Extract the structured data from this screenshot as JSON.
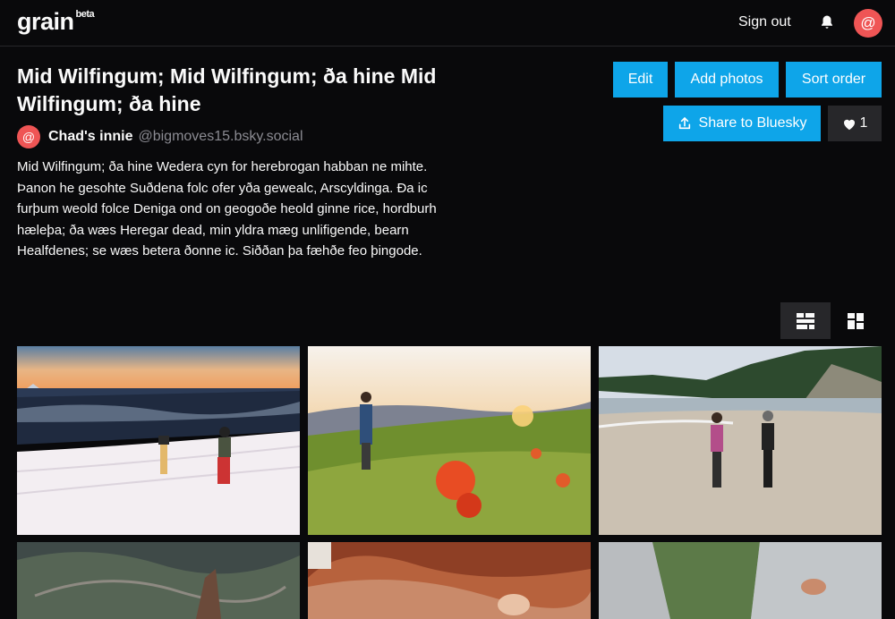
{
  "header": {
    "logo": "grain",
    "logo_sup": "beta",
    "sign_out_label": "Sign out",
    "avatar_glyph": "@"
  },
  "gallery": {
    "title": "Mid Wilfingum; Mid Wilfingum; ða hine Mid Wilfingum; ða hine",
    "author_name": "Chad's innie",
    "author_handle": "@bigmoves15.bsky.social",
    "author_avatar_glyph": "@",
    "description": "Mid Wilfingum; ða hine Wedera cyn for herebrogan habban ne mihte. Þanon he gesohte Suðdena folc ofer yða gewealc, Arscyldinga. Ða ic furþum weold folce Deniga ond on geogoðe heold ginne rice, hordburh hæleþa; ða wæs Heregar dead, min yldra mæg unlifigende, bearn Healfdenes; se wæs betera ðonne ic. Siððan þa fæhðe feo þingode."
  },
  "actions": {
    "edit_label": "Edit",
    "add_photos_label": "Add photos",
    "sort_order_label": "Sort order",
    "share_label": "Share to Bluesky",
    "like_count": "1"
  },
  "view_toggle": {
    "active": "masonry"
  },
  "colors": {
    "accent": "#0ea5e9",
    "avatar": "#ef5555",
    "background": "#09090b",
    "muted_button": "#27272a"
  },
  "photos": [
    {
      "subject": "two skiers climbing a snowy slope at sunset"
    },
    {
      "subject": "hiker standing in a meadow of red wildflowers at sunset"
    },
    {
      "subject": "two backpackers walking on a beach with trekking poles"
    },
    {
      "subject": "aerial view of mountains and a winding river"
    },
    {
      "subject": "climber's hand gripping orange sandstone"
    },
    {
      "subject": "climber reaching up a grey rock face"
    }
  ]
}
